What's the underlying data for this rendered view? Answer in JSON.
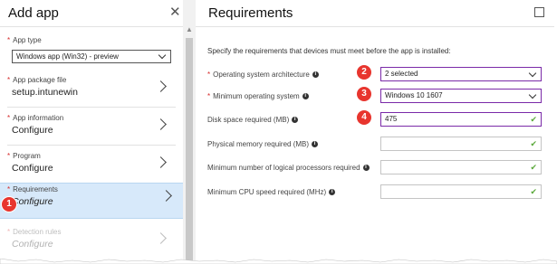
{
  "left_panel": {
    "title": "Add app",
    "app_type": {
      "label": "App type",
      "value": "Windows app (Win32) - preview"
    },
    "steps": [
      {
        "label": "App package file",
        "value": "setup.intunewin",
        "required": true
      },
      {
        "label": "App information",
        "value": "Configure",
        "required": true
      },
      {
        "label": "Program",
        "value": "Configure",
        "required": true
      },
      {
        "label": "Requirements",
        "value": "Configure",
        "required": true,
        "active": true,
        "badge": "1"
      },
      {
        "label": "Detection rules",
        "value": "Configure",
        "required": true,
        "faded": true
      }
    ]
  },
  "right_panel": {
    "title": "Requirements",
    "description": "Specify the requirements that devices must meet before the app is installed:",
    "fields": [
      {
        "label": "Operating system architecture",
        "required": true,
        "value": "2 selected",
        "badge": "2",
        "kind": "dropdown"
      },
      {
        "label": "Minimum operating system",
        "required": true,
        "value": "Windows 10 1607",
        "badge": "3",
        "kind": "dropdown"
      },
      {
        "label": "Disk space required (MB)",
        "required": false,
        "value": "475",
        "badge": "4",
        "kind": "text"
      },
      {
        "label": "Physical memory required (MB)",
        "required": false,
        "value": "",
        "kind": "text"
      },
      {
        "label": "Minimum number of logical processors required",
        "required": false,
        "value": "",
        "kind": "text"
      },
      {
        "label": "Minimum CPU speed required (MHz)",
        "required": false,
        "value": "",
        "kind": "text"
      }
    ]
  },
  "colors": {
    "accent_badge": "#e8352e",
    "active_step_bg": "#d7e9fa",
    "field_focus_border": "#7a2aa8",
    "check": "#5aa83a"
  },
  "icons": {
    "close": "close-icon",
    "maximize": "maximize-icon",
    "info": "info-icon",
    "chevron": "chevron-right-icon",
    "check": "check-icon"
  }
}
